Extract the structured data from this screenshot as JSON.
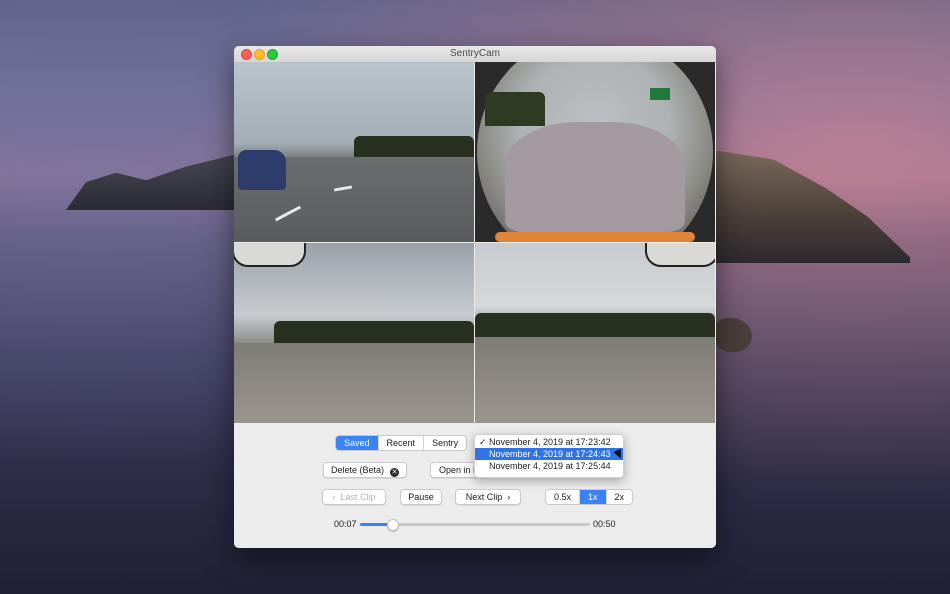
{
  "window": {
    "title": "SentryCam"
  },
  "cameras": {
    "front": "front-camera",
    "back": "back-camera",
    "left": "left-repeater",
    "right": "right-repeater"
  },
  "source_tabs": [
    {
      "label": "Saved",
      "active": true
    },
    {
      "label": "Recent",
      "active": false
    },
    {
      "label": "Sentry",
      "active": false
    }
  ],
  "clip_menu": {
    "items": [
      {
        "label": "November 4, 2019 at 17:23:42",
        "checked": true,
        "highlighted": false
      },
      {
        "label": "November 4, 2019 at 17:24:43",
        "checked": false,
        "highlighted": true
      },
      {
        "label": "November 4, 2019 at 17:25:44",
        "checked": false,
        "highlighted": false
      }
    ]
  },
  "buttons": {
    "delete_label": "Delete (Beta)",
    "open_label": "Open in F",
    "last_clip_label": "Last Clip",
    "pause_label": "Pause",
    "next_clip_label": "Next Clip"
  },
  "speed": [
    {
      "label": "0.5x",
      "active": false
    },
    {
      "label": "1x",
      "active": true
    },
    {
      "label": "2x",
      "active": false
    }
  ],
  "playback": {
    "current": "00:07",
    "total": "00:50",
    "progress": 0.14
  },
  "colors": {
    "accent": "#3a82f7",
    "menu_highlight": "#2f74e6"
  }
}
